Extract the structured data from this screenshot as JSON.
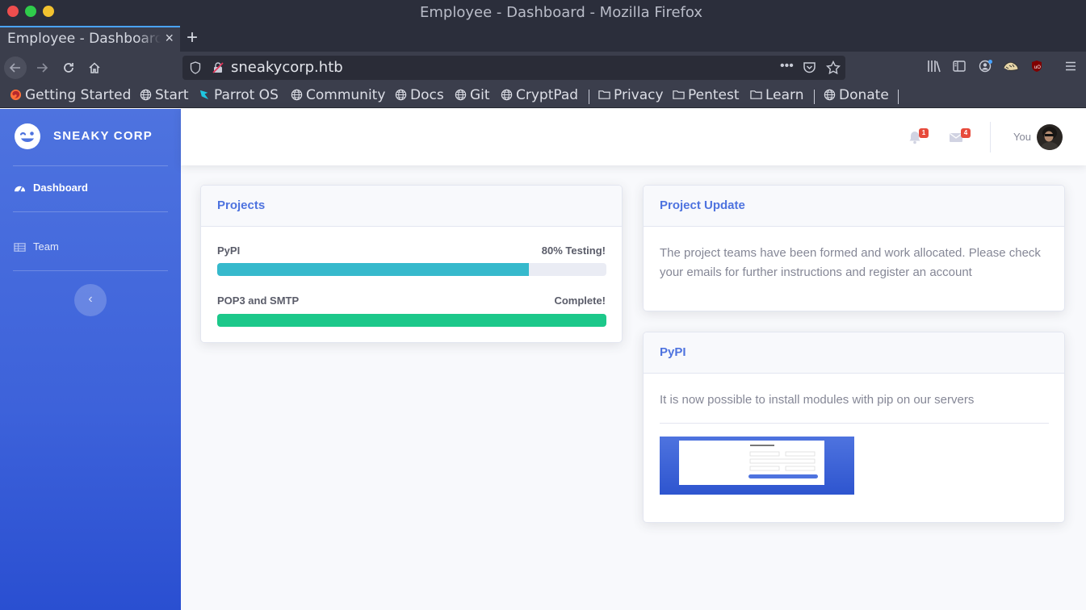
{
  "browser": {
    "window_title": "Employee - Dashboard - Mozilla Firefox",
    "tab_title": "Employee - Dashboard",
    "tab_close": "×",
    "new_tab": "+",
    "url": "sneakycorp.htb",
    "bookmarks": [
      {
        "label": "Getting Started",
        "icon": "firefox-icon"
      },
      {
        "label": "Start",
        "icon": "globe-icon"
      },
      {
        "label": "Parrot OS",
        "icon": "parrot-icon"
      },
      {
        "label": "Community",
        "icon": "globe-icon"
      },
      {
        "label": "Docs",
        "icon": "globe-icon"
      },
      {
        "label": "Git",
        "icon": "globe-icon"
      },
      {
        "label": "CryptPad",
        "icon": "globe-icon"
      },
      {
        "label": "Privacy",
        "icon": "folder-icon"
      },
      {
        "label": "Pentest",
        "icon": "folder-icon"
      },
      {
        "label": "Learn",
        "icon": "folder-icon"
      },
      {
        "label": "Donate",
        "icon": "globe-icon"
      }
    ]
  },
  "sidebar": {
    "brand": "SNEAKY CORP",
    "items": [
      {
        "label": "Dashboard",
        "icon": "tachometer-icon",
        "active": true
      },
      {
        "label": "Team",
        "icon": "table-icon",
        "active": false
      }
    ],
    "toggle_label": "‹"
  },
  "topbar": {
    "alerts_count": "1",
    "messages_count": "4",
    "user_label": "You"
  },
  "projects_card": {
    "title": "Projects",
    "items": [
      {
        "label": "PyPI",
        "status": "80% Testing!",
        "progress": 0.8,
        "color": "#36b9cc"
      },
      {
        "label": "POP3 and SMTP",
        "status": "Complete!",
        "progress": 1.0,
        "color": "#1cc88a"
      }
    ]
  },
  "update_card": {
    "title": "Project Update",
    "text": "The project teams have been formed and work allocated. Please check your emails for further instructions and register an account"
  },
  "pypi_card": {
    "title": "PyPI",
    "text": "It is now possible to install modules with pip on our servers"
  },
  "colors": {
    "primary": "#4e73df",
    "danger": "#e74a3b"
  }
}
